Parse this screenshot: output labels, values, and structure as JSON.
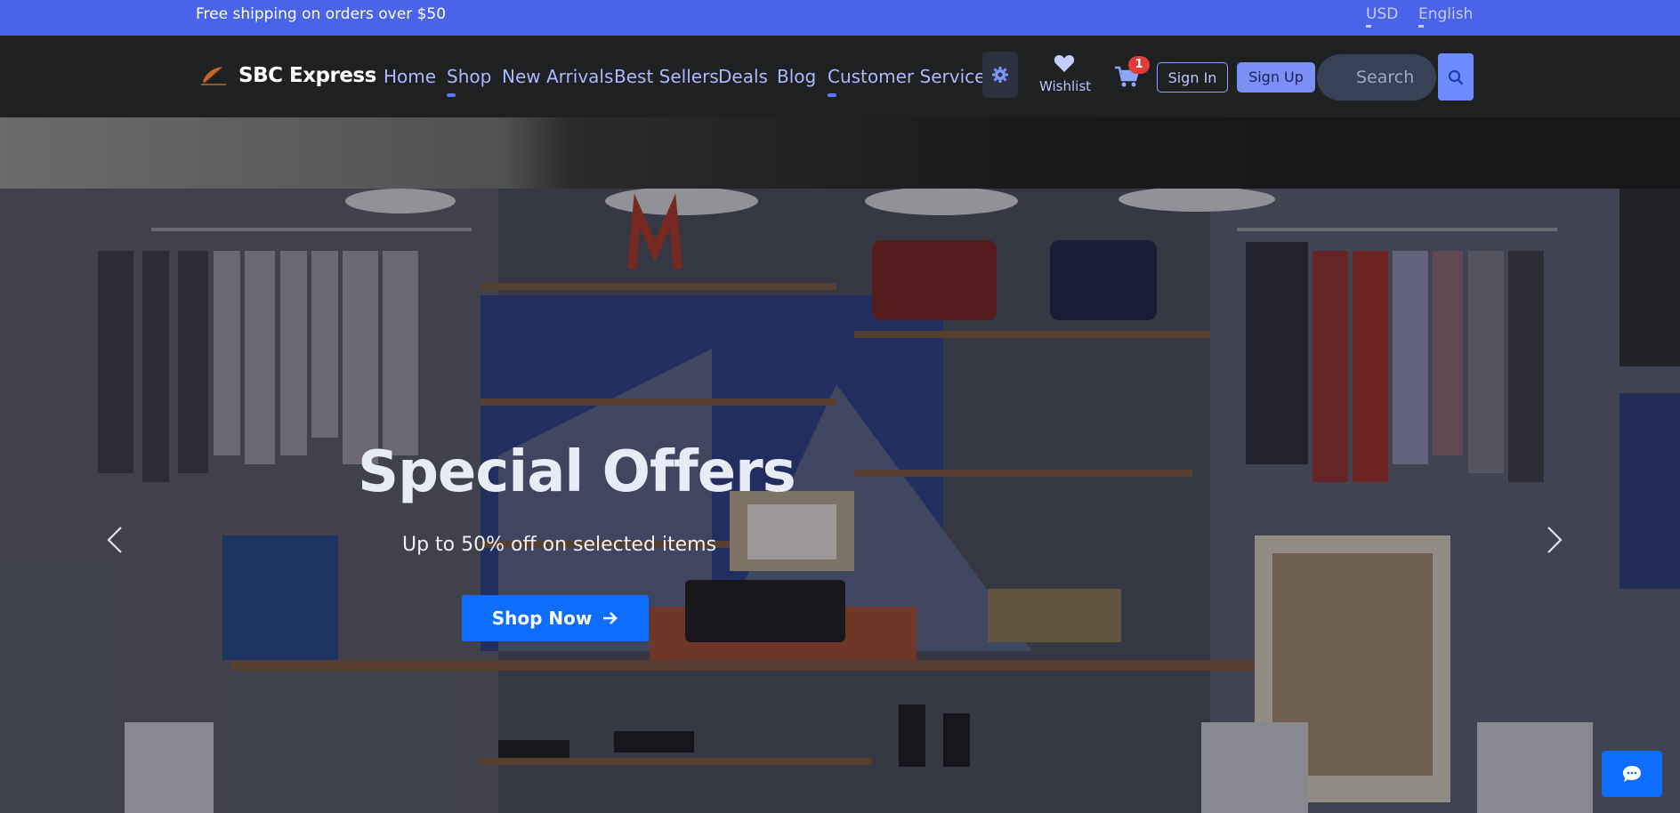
{
  "topbar": {
    "shipping": "Free shipping on orders over $50",
    "currency": "USD",
    "language": "English"
  },
  "brand": {
    "name": "SBC Express",
    "logo_icon": "leaf-logo-icon"
  },
  "menu": [
    "Home",
    "Shop",
    "New Arrivals",
    "Best Sellers",
    "Deals",
    "Blog",
    "Customer Service"
  ],
  "actions": {
    "wishlist": "Wishlist",
    "cart_count": "1",
    "sign_in": "Sign In",
    "sign_up": "Sign Up",
    "search_placeholder": "Search"
  },
  "hero": {
    "title": "Special Offers",
    "subtitle": "Up to 50% off on selected items",
    "cta": "Shop Now"
  },
  "colors": {
    "topbar": "#4b63ea",
    "nav": "#1f2022",
    "primary": "#0d6efd",
    "link": "#aab8ff",
    "badge": "#e03b3b"
  },
  "icons": [
    "gear-icon",
    "heart-icon",
    "cart-icon",
    "search-icon",
    "chevron-left-icon",
    "chevron-right-icon",
    "arrow-right-icon",
    "chat-icon"
  ]
}
